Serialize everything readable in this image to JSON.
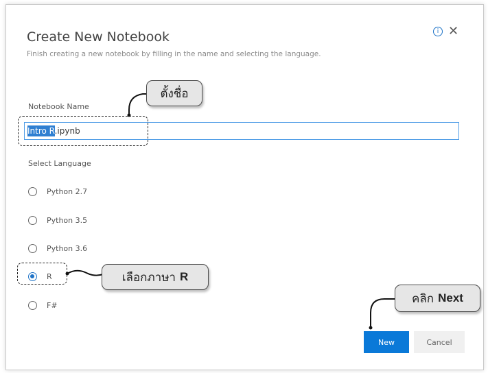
{
  "dialog": {
    "title": "Create New Notebook",
    "subtitle": "Finish creating a new notebook by filling in the name and selecting the language.",
    "info_icon": "info-icon",
    "close_icon": "✕"
  },
  "notebook_name": {
    "label": "Notebook Name",
    "value_selected": "Intro R",
    "value_rest": ".ipynb"
  },
  "language": {
    "label": "Select Language",
    "options": [
      {
        "label": "Python 2.7",
        "checked": false
      },
      {
        "label": "Python 3.5",
        "checked": false
      },
      {
        "label": "Python 3.6",
        "checked": false
      },
      {
        "label": "R",
        "checked": true
      },
      {
        "label": "F#",
        "checked": false
      }
    ]
  },
  "buttons": {
    "new_label": "New",
    "cancel_label": "Cancel"
  },
  "annotations": {
    "name_callout": "ตั้งชื่อ",
    "lang_callout_text": "เลือกภาษา",
    "lang_callout_bold": "R",
    "next_callout_text": "คลิก",
    "next_callout_bold": "Next"
  },
  "colors": {
    "accent": "#0a79d8",
    "selection": "#2f7fd1",
    "callout_bg": "#e6e6e6"
  }
}
